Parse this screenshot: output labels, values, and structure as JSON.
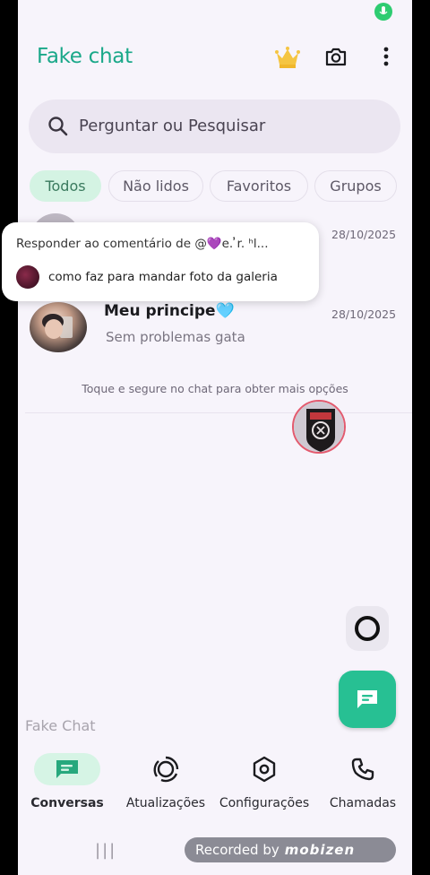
{
  "app": {
    "title": "Fake chat"
  },
  "search": {
    "placeholder": "Perguntar ou Pesquisar"
  },
  "filters": [
    {
      "label": "Todos",
      "active": true
    },
    {
      "label": "Não lidos",
      "active": false
    },
    {
      "label": "Favoritos",
      "active": false
    },
    {
      "label": "Grupos",
      "active": false
    }
  ],
  "chats": [
    {
      "name": "",
      "message": "",
      "date": "28/10/2025"
    },
    {
      "name": "Meu principe🩵",
      "message": "Sem problemas gata",
      "date": "28/10/2025"
    }
  ],
  "hint": "Toque e segure no chat para obter mais opções",
  "overlay": {
    "line1": "Responder ao comentário de @💜e. ̓r. ʰl...",
    "line2": "como faz para mandar foto da galeria"
  },
  "watermark": "Fake Chat",
  "nav": [
    {
      "label": "Conversas",
      "icon": "chat-icon",
      "active": true
    },
    {
      "label": "Atualizações",
      "icon": "updates-icon",
      "active": false
    },
    {
      "label": "Configurações",
      "icon": "settings-icon",
      "active": false
    },
    {
      "label": "Chamadas",
      "icon": "phone-icon",
      "active": false
    }
  ],
  "recorder": {
    "prefix": "Recorded by",
    "brand": "mobizen"
  },
  "colors": {
    "accent": "#27c093",
    "title": "#1aa889",
    "active_chip": "#d4f3e3",
    "background": "#f7f4fb"
  }
}
